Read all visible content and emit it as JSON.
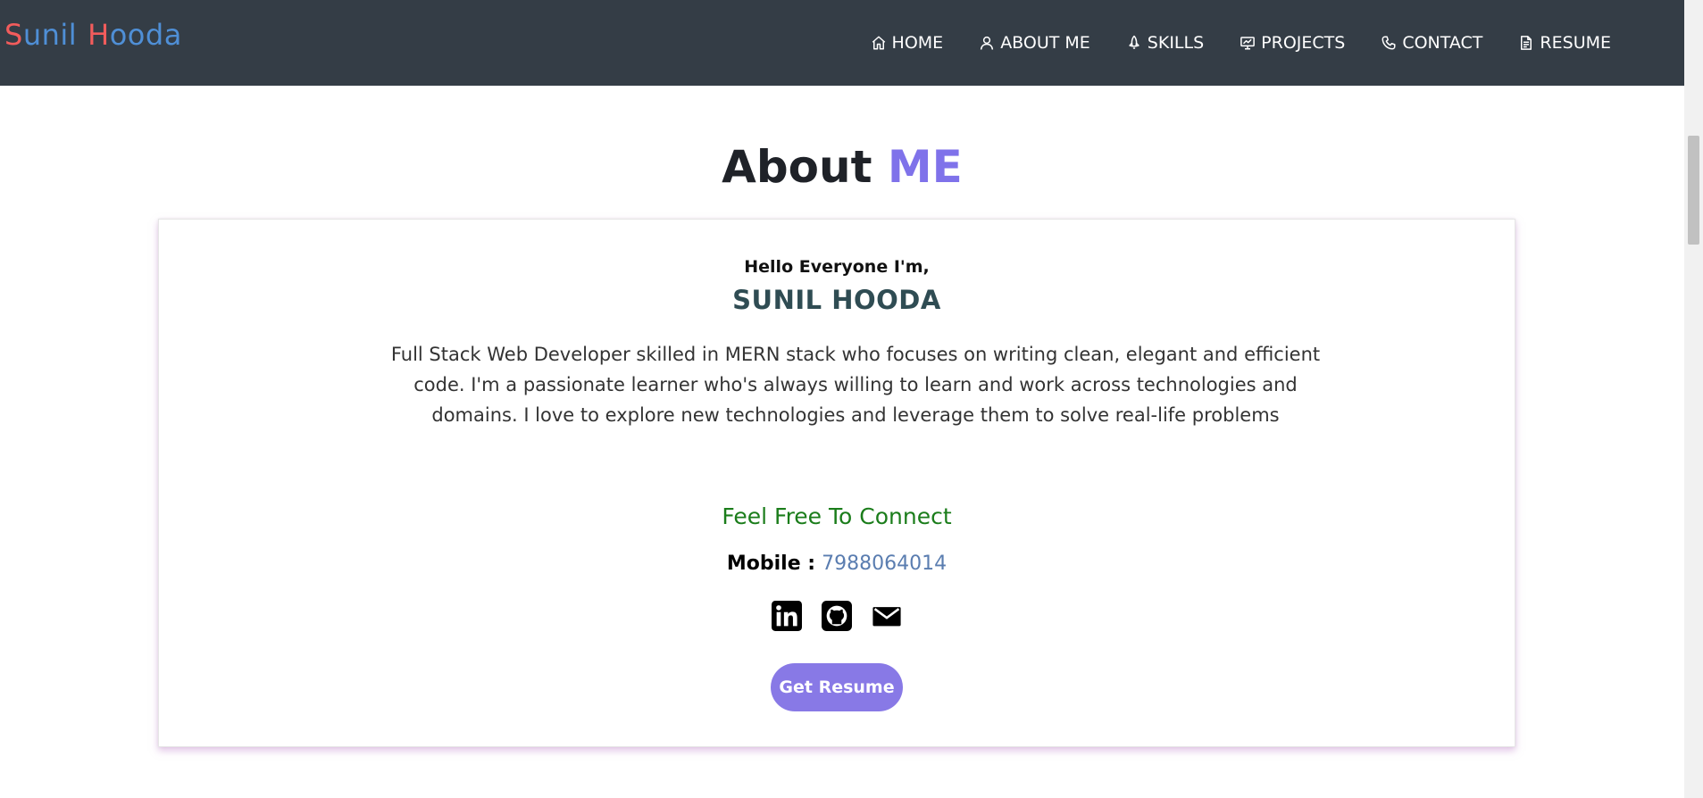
{
  "brand": {
    "first_cap": "S",
    "first_rest": "unil",
    "last_cap": "H",
    "last_rest": "ooda",
    "cap_color": "#f25c5c",
    "rest_color": "#4f8fd6"
  },
  "nav": {
    "items": [
      {
        "label": "HOME",
        "icon": "home-icon"
      },
      {
        "label": "ABOUT ME",
        "icon": "user-icon"
      },
      {
        "label": "SKILLS",
        "icon": "rocket-icon"
      },
      {
        "label": "PROJECTS",
        "icon": "presentation-icon"
      },
      {
        "label": "CONTACT",
        "icon": "phone-icon"
      },
      {
        "label": "RESUME",
        "icon": "document-icon"
      }
    ]
  },
  "section": {
    "title_plain": "About",
    "title_accent": "ME",
    "accent_color": "#7f72ea"
  },
  "about": {
    "greeting": "Hello Everyone I'm,",
    "name": "SUNIL HOODA",
    "bio": "Full Stack Web Developer skilled in MERN stack who focuses on writing clean, elegant and efficient code. I'm a passionate learner who's always willing to learn and work across technologies and domains. I love to explore new technologies and leverage them to solve real-life problems",
    "connect_heading": "Feel Free To Connect",
    "mobile_label": "Mobile :",
    "mobile_number": "7988064014",
    "social": [
      "linkedin-icon",
      "github-icon",
      "email-icon"
    ],
    "resume_button": "Get Resume",
    "button_color": "#8879e6"
  }
}
